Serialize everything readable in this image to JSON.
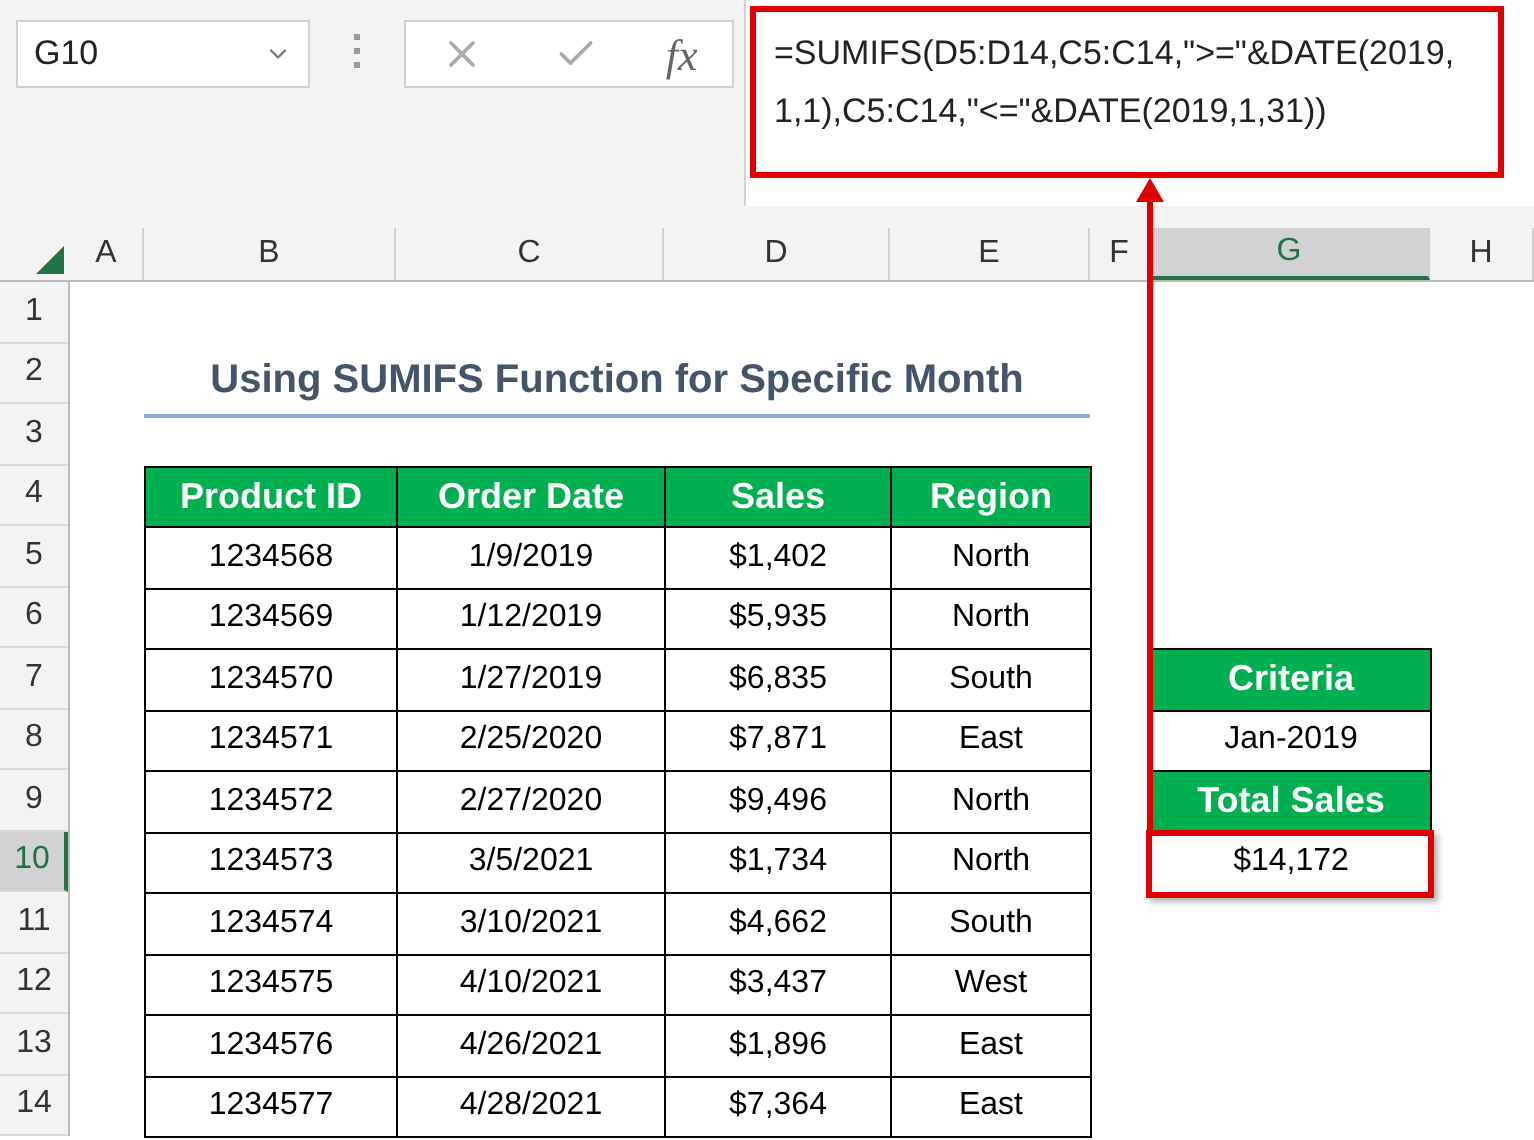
{
  "name_box": "G10",
  "formula_bar": {
    "function_label": "fx",
    "formula": "=SUMIFS(D5:D14,C5:C14,\">=\"&DATE(2019,1,1),C5:C14,\"<=\"&DATE(2019,1,31))",
    "highlighted": true
  },
  "columns": [
    {
      "label": "A",
      "selected": false
    },
    {
      "label": "B",
      "selected": false
    },
    {
      "label": "C",
      "selected": false
    },
    {
      "label": "D",
      "selected": false
    },
    {
      "label": "E",
      "selected": false
    },
    {
      "label": "F",
      "selected": false
    },
    {
      "label": "G",
      "selected": true
    },
    {
      "label": "H",
      "selected": false
    }
  ],
  "rows": [
    {
      "label": "1",
      "selected": false
    },
    {
      "label": "2",
      "selected": false
    },
    {
      "label": "3",
      "selected": false
    },
    {
      "label": "4",
      "selected": false
    },
    {
      "label": "5",
      "selected": false
    },
    {
      "label": "6",
      "selected": false
    },
    {
      "label": "7",
      "selected": false
    },
    {
      "label": "8",
      "selected": false
    },
    {
      "label": "9",
      "selected": false
    },
    {
      "label": "10",
      "selected": true
    },
    {
      "label": "11",
      "selected": false
    },
    {
      "label": "12",
      "selected": false
    },
    {
      "label": "13",
      "selected": false
    },
    {
      "label": "14",
      "selected": false
    }
  ],
  "title": "Using SUMIFS Function for Specific Month",
  "table": {
    "columns": [
      "Product ID",
      "Order Date",
      "Sales",
      "Region"
    ],
    "rows": [
      [
        "1234568",
        "1/9/2019",
        "$1,402",
        "North"
      ],
      [
        "1234569",
        "1/12/2019",
        "$5,935",
        "North"
      ],
      [
        "1234570",
        "1/27/2019",
        "$6,835",
        "South"
      ],
      [
        "1234571",
        "2/25/2020",
        "$7,871",
        "East"
      ],
      [
        "1234572",
        "2/27/2020",
        "$9,496",
        "North"
      ],
      [
        "1234573",
        "3/5/2021",
        "$1,734",
        "North"
      ],
      [
        "1234574",
        "3/10/2021",
        "$4,662",
        "South"
      ],
      [
        "1234575",
        "4/10/2021",
        "$3,437",
        "West"
      ],
      [
        "1234576",
        "4/26/2021",
        "$1,896",
        "East"
      ],
      [
        "1234577",
        "4/28/2021",
        "$7,364",
        "East"
      ]
    ]
  },
  "criteria": {
    "heading": "Criteria",
    "value": "Jan-2019",
    "result_heading": "Total Sales",
    "result": "$14,172",
    "result_highlighted": true
  }
}
